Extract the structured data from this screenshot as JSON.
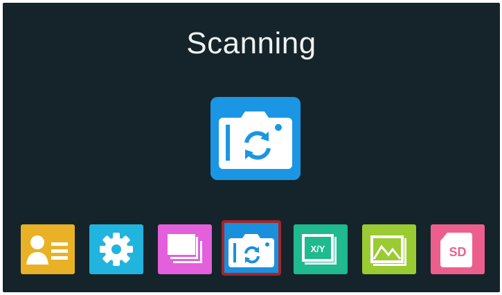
{
  "screen": {
    "title": "Scanning"
  },
  "hero_icon": {
    "icon": "camera-scan-icon",
    "color": "#1a96e4"
  },
  "menu": {
    "selected_index": 3,
    "items": [
      {
        "icon": "contact-card-icon",
        "color": "#e8b126"
      },
      {
        "icon": "gear-icon",
        "color": "#21b4de"
      },
      {
        "icon": "pages-icon",
        "color": "#e35fdc"
      },
      {
        "icon": "camera-scan-icon",
        "color": "#1a90dc"
      },
      {
        "icon": "xy-icon",
        "color": "#1fba8f",
        "label": "X/Y"
      },
      {
        "icon": "gallery-icon",
        "color": "#9acb32"
      },
      {
        "icon": "sd-card-icon",
        "color": "#ec5f8d",
        "label": "SD"
      }
    ]
  },
  "colors": {
    "background": "#15242a",
    "selection_border": "#a4262c",
    "title_text": "#eef2f2"
  }
}
